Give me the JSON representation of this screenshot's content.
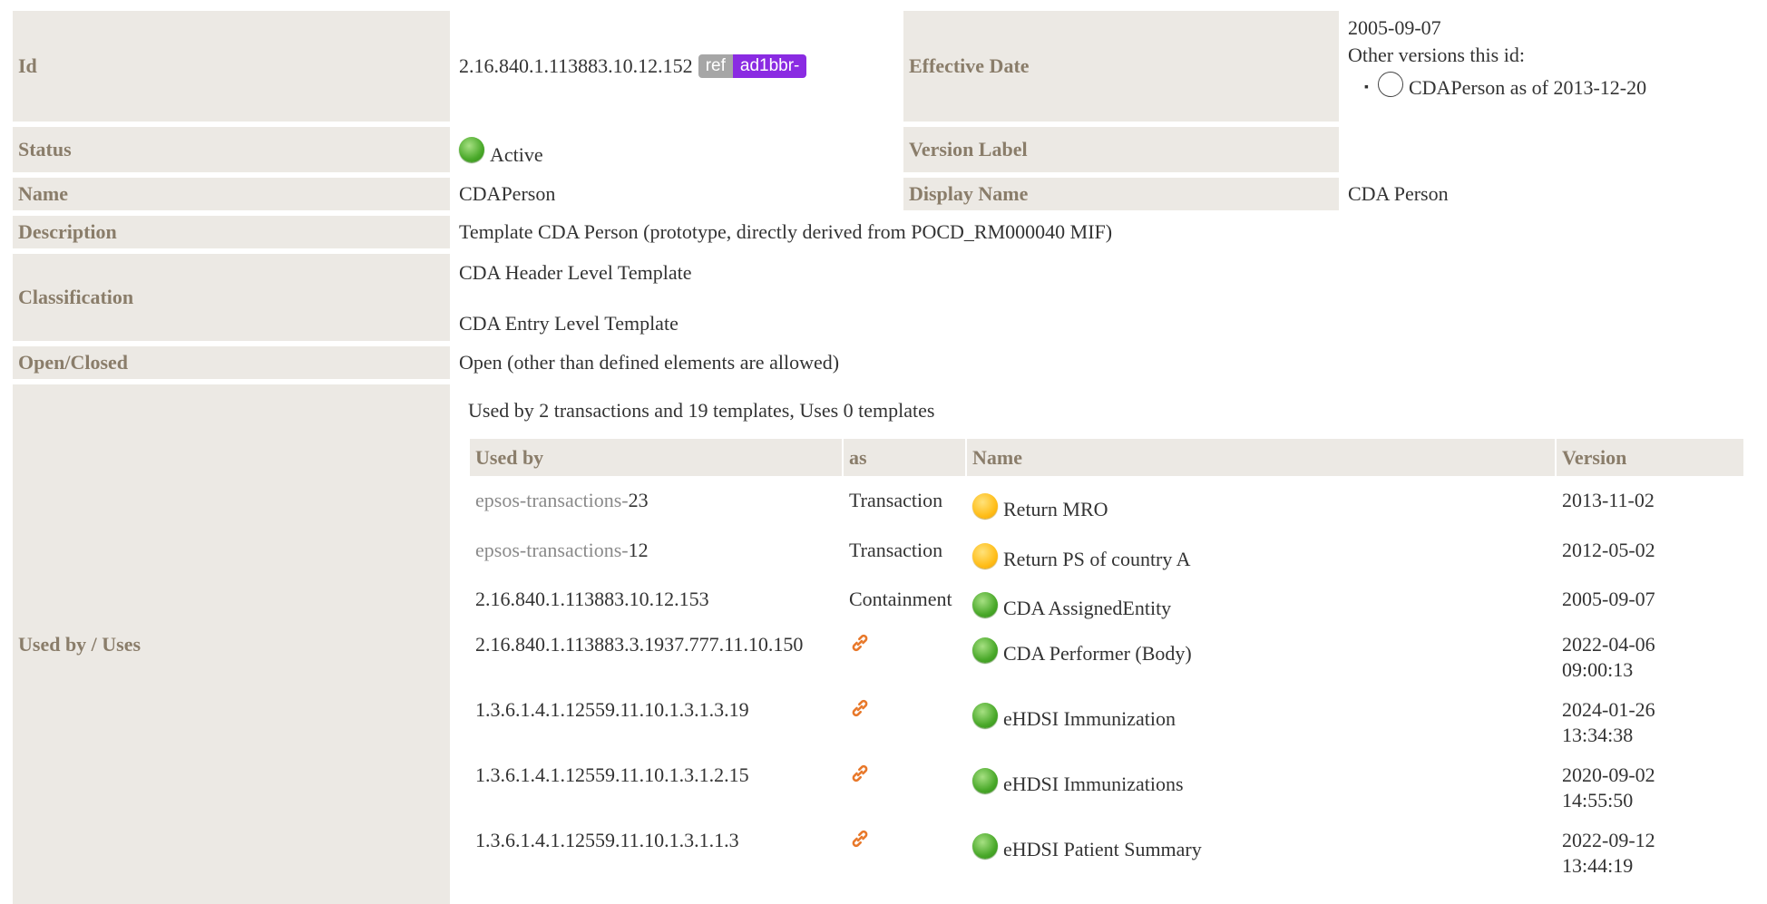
{
  "fields": {
    "id_label": "Id",
    "id_value": "2.16.840.1.113883.10.12.152",
    "ref_badge": "ref",
    "project_badge": "ad1bbr-",
    "effective_date_label": "Effective Date",
    "effective_date_value": "2005-09-07",
    "other_versions_label": "Other versions this id:",
    "other_version_item": "CDAPerson as of 2013-12-20",
    "status_label": "Status",
    "status_value": "Active",
    "version_label_label": "Version Label",
    "name_label": "Name",
    "name_value": "CDAPerson",
    "display_name_label": "Display Name",
    "display_name_value": "CDA Person",
    "description_label": "Description",
    "description_value": "Template CDA Person (prototype, directly derived from POCD_RM000040 MIF)",
    "classification_label": "Classification",
    "classification_1": "CDA Header Level Template",
    "classification_2": "CDA Entry Level Template",
    "open_closed_label": "Open/Closed",
    "open_closed_value": "Open (other than defined elements are allowed)",
    "used_by_label": "Used by / Uses"
  },
  "usage": {
    "summary": "Used by 2 transactions and 19 templates, Uses 0 templates",
    "headers": [
      "Used by",
      "as",
      "Name",
      "Version"
    ],
    "rows": [
      {
        "prefix": "epsos-transactions-",
        "id": "23",
        "as": "Transaction",
        "status": "yellow",
        "name": "Return MRO",
        "version": "2013-11-02",
        "version2": ""
      },
      {
        "prefix": "epsos-transactions-",
        "id": "12",
        "as": "Transaction",
        "status": "yellow",
        "name": "Return PS of country A",
        "version": "2012-05-02",
        "version2": ""
      },
      {
        "prefix": "",
        "id": "2.16.840.1.113883.10.12.153",
        "as": "Containment",
        "status": "green",
        "name": "CDA AssignedEntity",
        "version": "2005-09-07",
        "version2": ""
      },
      {
        "prefix": "",
        "id": "2.16.840.1.113883.3.1937.777.11.10.150",
        "as": "",
        "link": true,
        "status": "green",
        "name": "CDA Performer (Body)",
        "version": "2022-04-06",
        "version2": "09:00:13"
      },
      {
        "prefix": "",
        "id": "1.3.6.1.4.1.12559.11.10.1.3.1.3.19",
        "as": "",
        "link": true,
        "status": "green",
        "name": "eHDSI Immunization",
        "version": "2024-01-26",
        "version2": "13:34:38"
      },
      {
        "prefix": "",
        "id": "1.3.6.1.4.1.12559.11.10.1.3.1.2.15",
        "as": "",
        "link": true,
        "status": "green",
        "name": "eHDSI Immunizations",
        "version": "2020-09-02",
        "version2": "14:55:50"
      },
      {
        "prefix": "",
        "id": "1.3.6.1.4.1.12559.11.10.1.3.1.1.3",
        "as": "",
        "link": true,
        "status": "green",
        "name": "eHDSI Patient Summary",
        "version": "2022-09-12",
        "version2": "13:44:19"
      }
    ]
  },
  "colors": {
    "label_bg": "#ece9e4",
    "label_text": "#8a7d6a",
    "active_green": "#4aa92a",
    "pending_yellow": "#ffbe1a",
    "project_badge": "#8a2be2",
    "link_orange": "#e8782a"
  }
}
